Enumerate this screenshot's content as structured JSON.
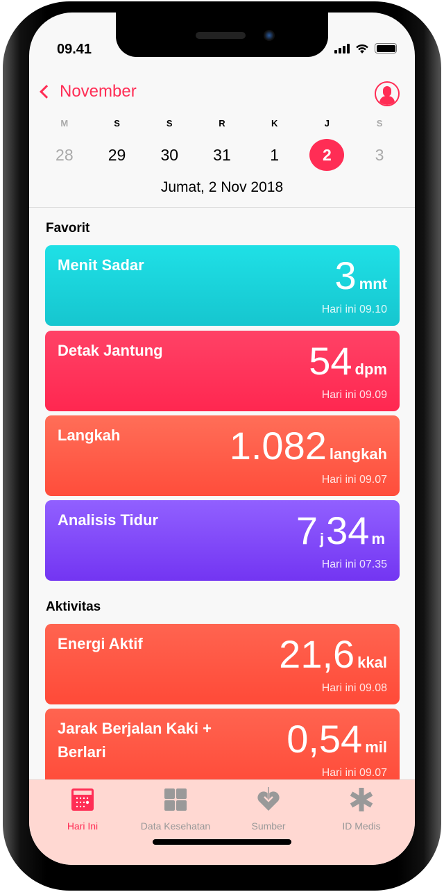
{
  "status": {
    "time": "09.41"
  },
  "header": {
    "month": "November"
  },
  "week": [
    {
      "letter": "M",
      "num": "28",
      "state": "dim"
    },
    {
      "letter": "S",
      "num": "29",
      "state": ""
    },
    {
      "letter": "S",
      "num": "30",
      "state": ""
    },
    {
      "letter": "R",
      "num": "31",
      "state": ""
    },
    {
      "letter": "K",
      "num": "1",
      "state": ""
    },
    {
      "letter": "J",
      "num": "2",
      "state": "selected"
    },
    {
      "letter": "S",
      "num": "3",
      "state": "dim"
    }
  ],
  "date": "Jumat, 2 Nov 2018",
  "sections": {
    "favorites": "Favorit",
    "activity": "Aktivitas"
  },
  "cards": [
    {
      "title": "Menit Sadar",
      "value": "3",
      "unit": "mnt",
      "time": "Hari ini 09.10",
      "color": "#1ed6de"
    },
    {
      "title": "Detak Jantung",
      "value": "54",
      "unit": "dpm",
      "time": "Hari ini 09.09",
      "color": "#ff2d55"
    },
    {
      "title": "Langkah",
      "value": "1.082",
      "unit": "langkah",
      "time": "Hari ini 09.07",
      "color": "#ff5a45"
    },
    {
      "title": "Analisis Tidur",
      "value_h": "7",
      "unit_h": "j",
      "value_m": "34",
      "unit_m": "m",
      "time": "Hari ini 07.35",
      "color": "#7d45f5"
    },
    {
      "title": "Energi Aktif",
      "value": "21,6",
      "unit": "kkal",
      "time": "Hari ini 09.08",
      "color": "#ff5a45"
    },
    {
      "title": "Jarak Berjalan Kaki + Berlari",
      "value": "0,54",
      "unit": "mil",
      "time": "Hari ini 09.07",
      "color": "#ff5a45"
    }
  ],
  "tabs": [
    {
      "label": "Hari Ini",
      "icon": "calendar-icon",
      "active": true
    },
    {
      "label": "Data Kesehatan",
      "icon": "grid-icon",
      "active": false
    },
    {
      "label": "Sumber",
      "icon": "heart-download-icon",
      "active": false
    },
    {
      "label": "ID Medis",
      "icon": "asterisk-icon",
      "active": false
    }
  ],
  "colors": {
    "accent": "#ff2d55",
    "inactive": "#999999"
  }
}
